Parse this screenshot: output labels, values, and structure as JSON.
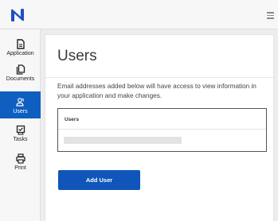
{
  "app": {
    "logo_icon": "n-logo-icon",
    "menu_icon": "hamburger-menu-icon",
    "accent_color": "#0f55ba"
  },
  "sidebar": {
    "items": [
      {
        "label": "Application",
        "icon": "document-icon",
        "active": false
      },
      {
        "label": "Documents",
        "icon": "documents-stack-icon",
        "active": false
      },
      {
        "label": "Users",
        "icon": "users-icon",
        "active": true
      },
      {
        "label": "Tasks",
        "icon": "tasks-check-icon",
        "active": false
      },
      {
        "label": "Print",
        "icon": "printer-icon",
        "active": false
      }
    ]
  },
  "main": {
    "title": "Users",
    "description": "Email addresses added below will have access to view information in your application and make changes.",
    "table": {
      "header": "Users"
    },
    "add_button_label": "Add User"
  }
}
